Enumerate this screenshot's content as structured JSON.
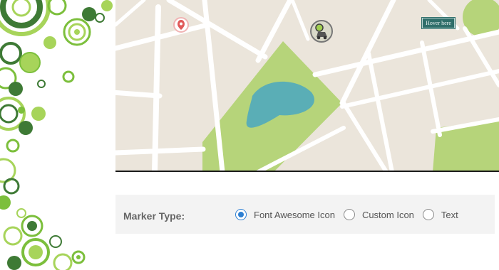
{
  "map": {
    "hover_label": "Hover here",
    "markers": [
      {
        "icon": "map-pin-icon",
        "color": "#e05a5a"
      },
      {
        "icon": "user-car-icon",
        "color": "#6e6e6e"
      }
    ],
    "colors": {
      "land": "#ebe5db",
      "road": "#ffffff",
      "park": "#b6d47a",
      "water": "#5aaeb6"
    }
  },
  "marker_options": {
    "label": "Marker Type:",
    "options": [
      {
        "label": "Font Awesome Icon",
        "checked": true
      },
      {
        "label": "Custom Icon",
        "checked": false
      },
      {
        "label": "Text",
        "checked": false
      }
    ]
  },
  "theme": {
    "accent": "#2d7fd2",
    "deco_dark": "#3e7a35",
    "deco_light": "#a7d45a"
  }
}
